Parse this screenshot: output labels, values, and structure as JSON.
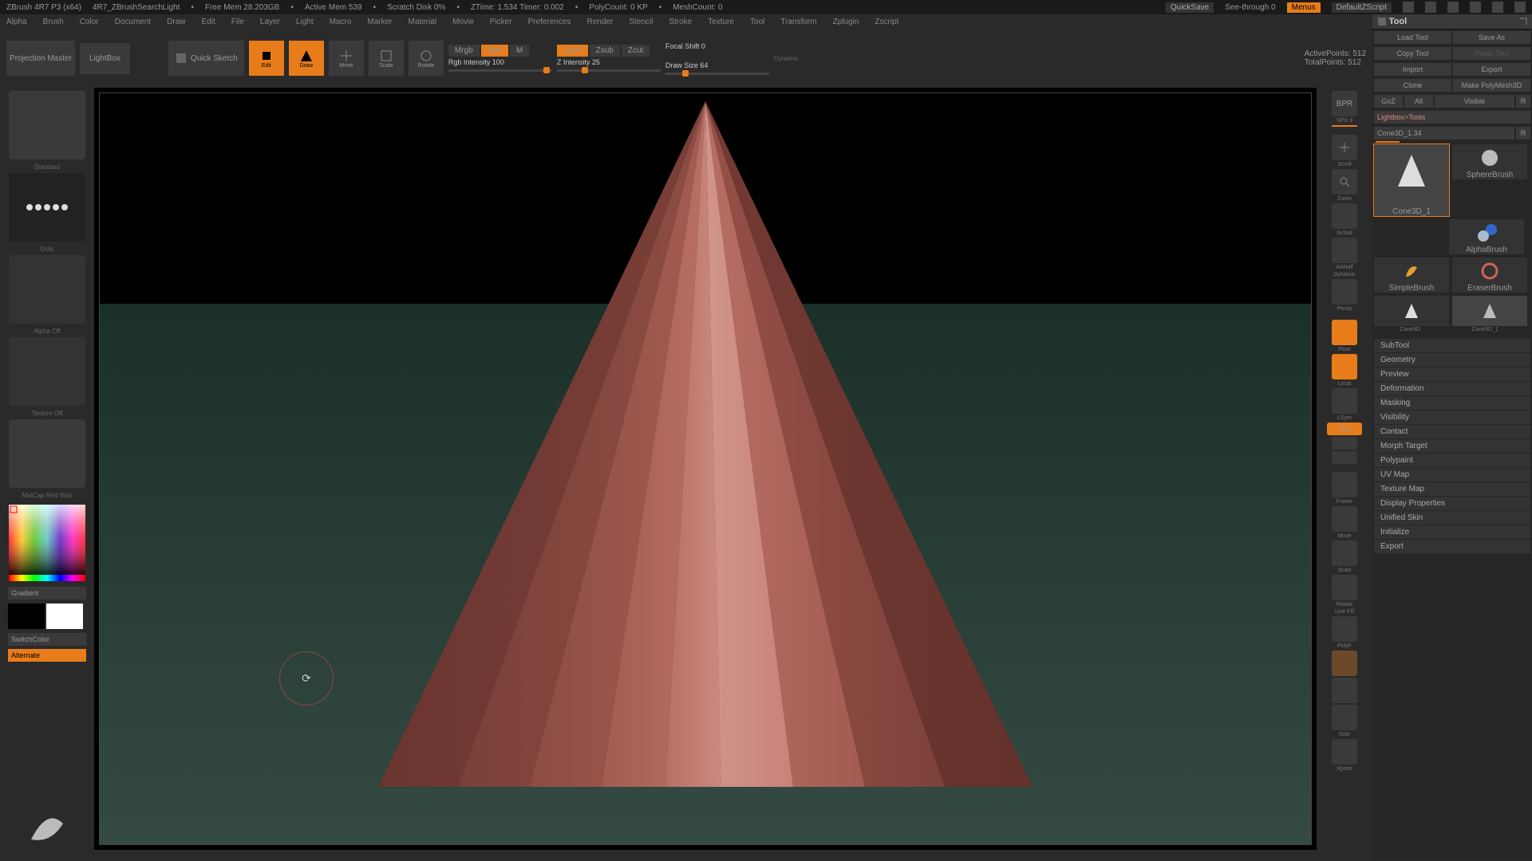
{
  "topbar": {
    "app": "ZBrush 4R7 P3 (x64)",
    "doc": "4R7_ZBrushSearchLight",
    "freemem": "Free Mem 28.203GB",
    "activemem": "Active Mem 539",
    "scratch": "Scratch Disk 0%",
    "ztime": "ZTime: 1.534 Timer: 0.002",
    "polycount": "PolyCount: 0 KP",
    "meshcount": "MeshCount: 0",
    "quicksave": "QuickSave",
    "seethrough": "See-through  0",
    "menus": "Menus",
    "script": "DefaultZScript"
  },
  "menubar": [
    "Alpha",
    "Brush",
    "Color",
    "Document",
    "Draw",
    "Edit",
    "File",
    "Layer",
    "Light",
    "Macro",
    "Marker",
    "Material",
    "Movie",
    "Picker",
    "Preferences",
    "Render",
    "Stencil",
    "Stroke",
    "Texture",
    "Tool",
    "Transform",
    "Zplugin",
    "Zscript"
  ],
  "toprow": {
    "projection": "Projection Master",
    "lightbox": "LightBox",
    "quicksketch": "Quick Sketch",
    "modes": [
      "Edit",
      "Draw",
      "Move",
      "Scale",
      "Rotate"
    ],
    "mrgb": "Mrgb",
    "rgb": "Rgb",
    "m": "M",
    "rgbint": "Rgb Intensity 100",
    "zadd": "Zadd",
    "zsub": "Zsub",
    "zcut": "Zcut",
    "zint": "Z Intensity 25",
    "focal": "Focal Shift 0",
    "drawsize": "Draw Size 64",
    "dynamic": "Dynamic",
    "activepts": "ActivePoints:  512",
    "totalpts": "TotalPoints:  512"
  },
  "leftpanel": {
    "brush": "Standard",
    "stroke": "Dots",
    "alpha": "Alpha Off",
    "texture": "Texture Off",
    "material": "MatCap Red Wax",
    "gradient": "Gradient",
    "switchcolor": "SwitchColor",
    "alternate": "Alternate"
  },
  "rightstrip": [
    "BPR",
    "SPix 3",
    "Scroll",
    "Zoom",
    "Actual",
    "AAHalf",
    "Dynamic",
    "Persp",
    "Floor",
    "Local",
    "LSym",
    "Xyz",
    "",
    "",
    "Frame",
    "Move",
    "Scale",
    "Rotate",
    "Line Fill",
    "PolyF",
    "",
    "",
    "Solo",
    "Xpose"
  ],
  "tool": {
    "title": "Tool",
    "loadtool": "Load Tool",
    "saveas": "Save As",
    "copytool": "Copy Tool",
    "pastetool": "Paste Tool",
    "import": "Import",
    "export": "Export",
    "clone": "Clone",
    "makepoly": "Make PolyMesh3D",
    "goz": "GoZ",
    "all": "All",
    "visible": "Visible",
    "r": "R",
    "lightboxtools": "Lightbox>Tools",
    "toolname": "Cone3D_1.34",
    "r2": "R",
    "slots": [
      "Cone3D_1",
      "SphereBrush",
      "AlphaBrush",
      "SimpleBrush",
      "EraserBrush",
      "Cone3D",
      "Cone3D_1"
    ],
    "sections": [
      "SubTool",
      "Geometry",
      "Preview",
      "Deformation",
      "Masking",
      "Visibility",
      "Contact",
      "Morph Target",
      "Polypaint",
      "UV Map",
      "Texture Map",
      "Display Properties",
      "Unified Skin",
      "Initialize",
      "Export"
    ]
  }
}
